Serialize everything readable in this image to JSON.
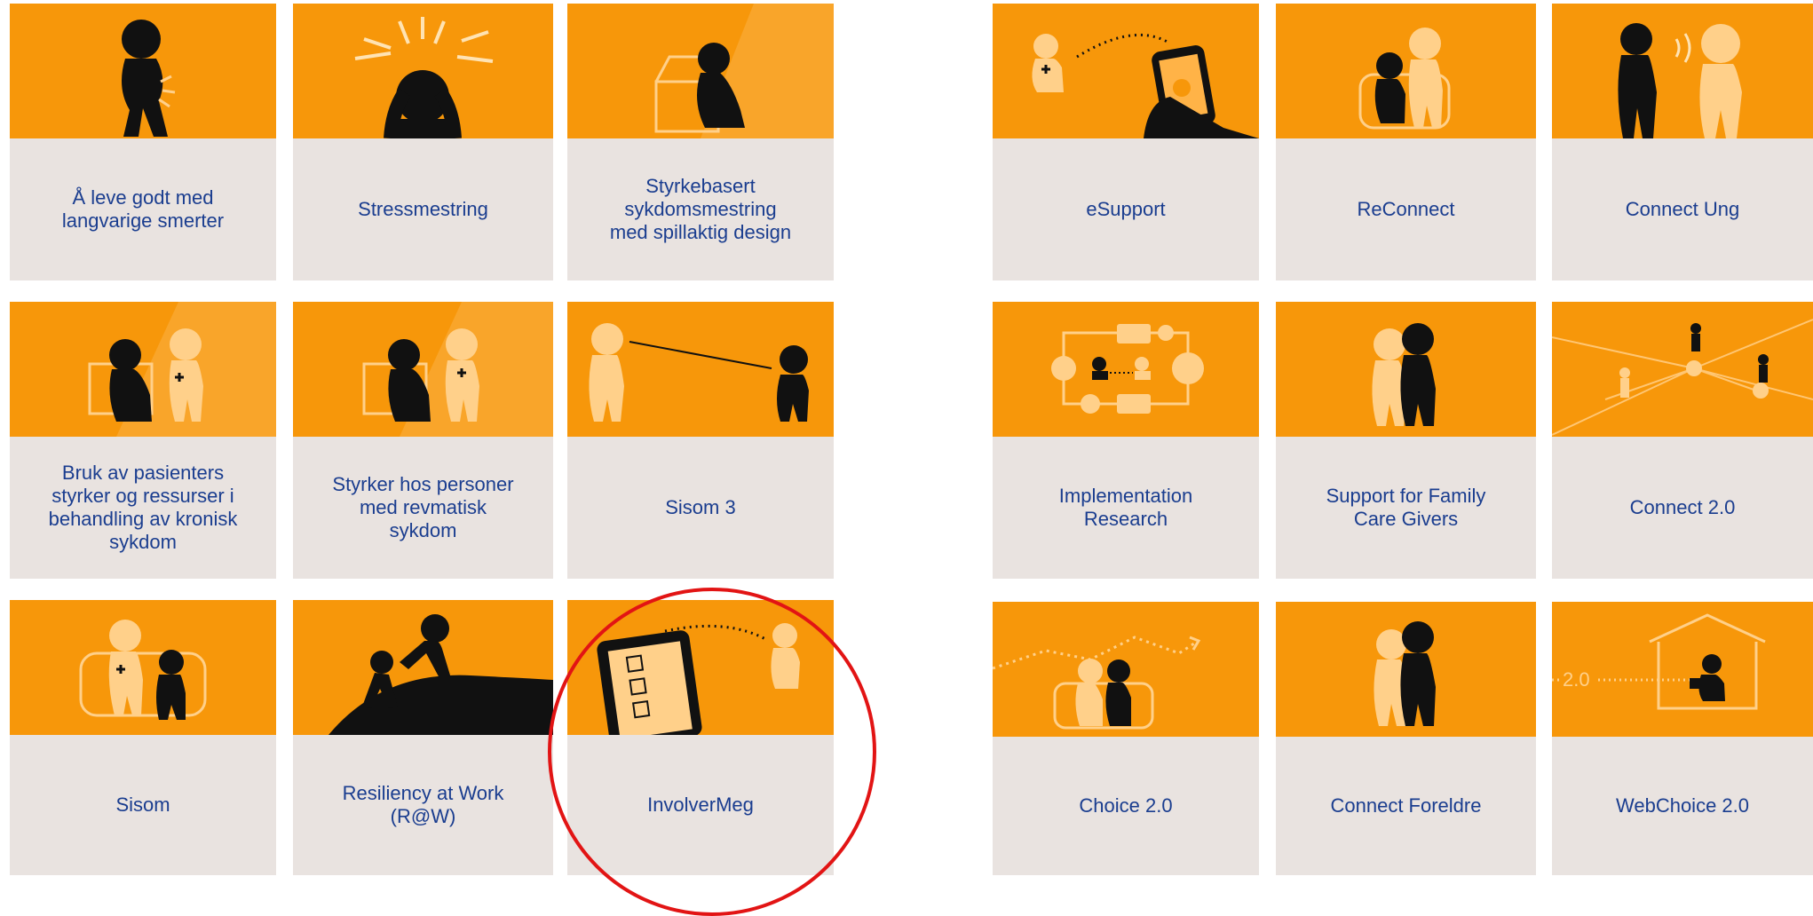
{
  "colors": {
    "tile_image": "#f7970a",
    "tile_body": "#e9e3e0",
    "label_text": "#1a3d8f",
    "highlight": "#e21414"
  },
  "left_grid": {
    "tiles": [
      {
        "label": "Å leve godt med\nlangvarige smerter",
        "icon": "person-back-pain-icon"
      },
      {
        "label": "Stressmestring",
        "icon": "stressed-person-icon"
      },
      {
        "label": "Styrkebasert\nsykdomsmestring\nmed spillaktig design",
        "icon": "treasure-chest-person-icon"
      },
      {
        "label": "Bruk av pasienters\nstyrker og ressurser i\nbehandling av kronisk\nsykdom",
        "icon": "chest-with-helper-icon"
      },
      {
        "label": "Styrker hos personer\nmed revmatisk\nsykdom",
        "icon": "chest-with-helper-icon"
      },
      {
        "label": "Sisom 3",
        "icon": "tin-can-phone-icon"
      },
      {
        "label": "Sisom",
        "icon": "child-with-laptop-icon"
      },
      {
        "label": "Resiliency at Work\n(R@W)",
        "icon": "helping-hand-hill-icon"
      },
      {
        "label": "InvolverMeg",
        "icon": "tablet-checklist-icon"
      }
    ]
  },
  "right_grid": {
    "tiles": [
      {
        "label": "eSupport",
        "icon": "phone-support-icon"
      },
      {
        "label": "ReConnect",
        "icon": "two-people-icon"
      },
      {
        "label": "Connect Ung",
        "icon": "young-person-talking-icon"
      },
      {
        "label": "Implementation\nResearch",
        "icon": "process-cycle-icon"
      },
      {
        "label": "Support for Family\nCare Givers",
        "icon": "family-caregiver-icon"
      },
      {
        "label": "Connect 2.0",
        "icon": "network-people-icon"
      },
      {
        "label": "Choice 2.0",
        "icon": "trend-line-people-icon"
      },
      {
        "label": "Connect Foreldre",
        "icon": "parents-icon"
      },
      {
        "label": "WebChoice 2.0",
        "icon": "house-laptop-icon",
        "badge": "2.0"
      }
    ]
  }
}
